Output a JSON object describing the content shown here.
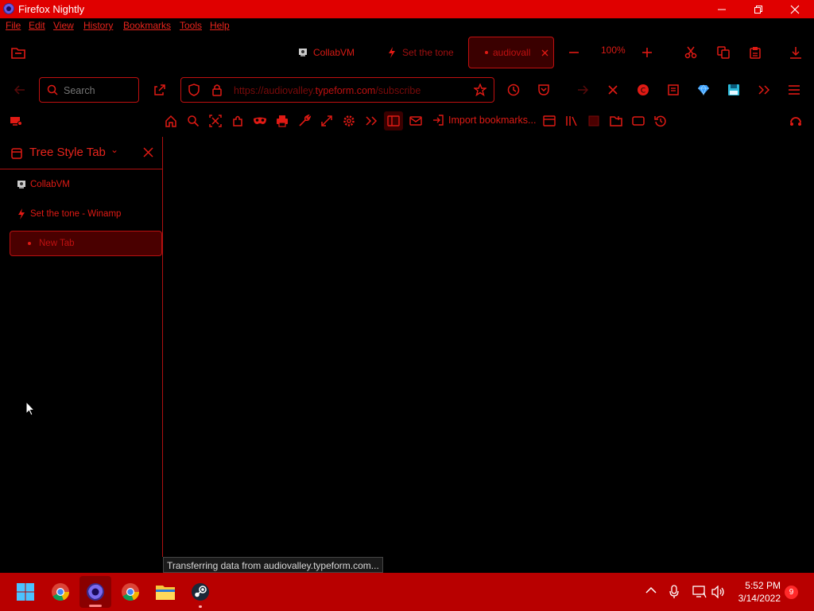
{
  "window": {
    "title": "Firefox Nightly"
  },
  "menu": [
    "File",
    "Edit",
    "View",
    "History",
    "Bookmarks",
    "Tools",
    "Help"
  ],
  "tabs": [
    {
      "label": "CollabVM"
    },
    {
      "label": "Set the tone"
    },
    {
      "label": "audiovall"
    }
  ],
  "zoom": "100%",
  "search": {
    "placeholder": "Search"
  },
  "url": {
    "prefix": "https://audiovalley.",
    "domain": "typeform.com",
    "path": "/subscribe"
  },
  "bookmarks_toolbar": {
    "import_label": "Import bookmarks..."
  },
  "sidebar": {
    "title": "Tree Style Tab",
    "chevron": "⌄",
    "items": [
      {
        "label": "CollabVM"
      },
      {
        "label": "Set the tone - Winamp"
      },
      {
        "label": "New Tab"
      }
    ]
  },
  "status": {
    "text": "Transferring data from audiovalley.typeform.com..."
  },
  "taskbar": {
    "time": "5:52 PM",
    "date": "3/14/2022",
    "badge": "9"
  },
  "colors": {
    "accent": "#e00000",
    "taskbar": "#b80000",
    "text_red": "#e01a14",
    "background": "#000000"
  }
}
